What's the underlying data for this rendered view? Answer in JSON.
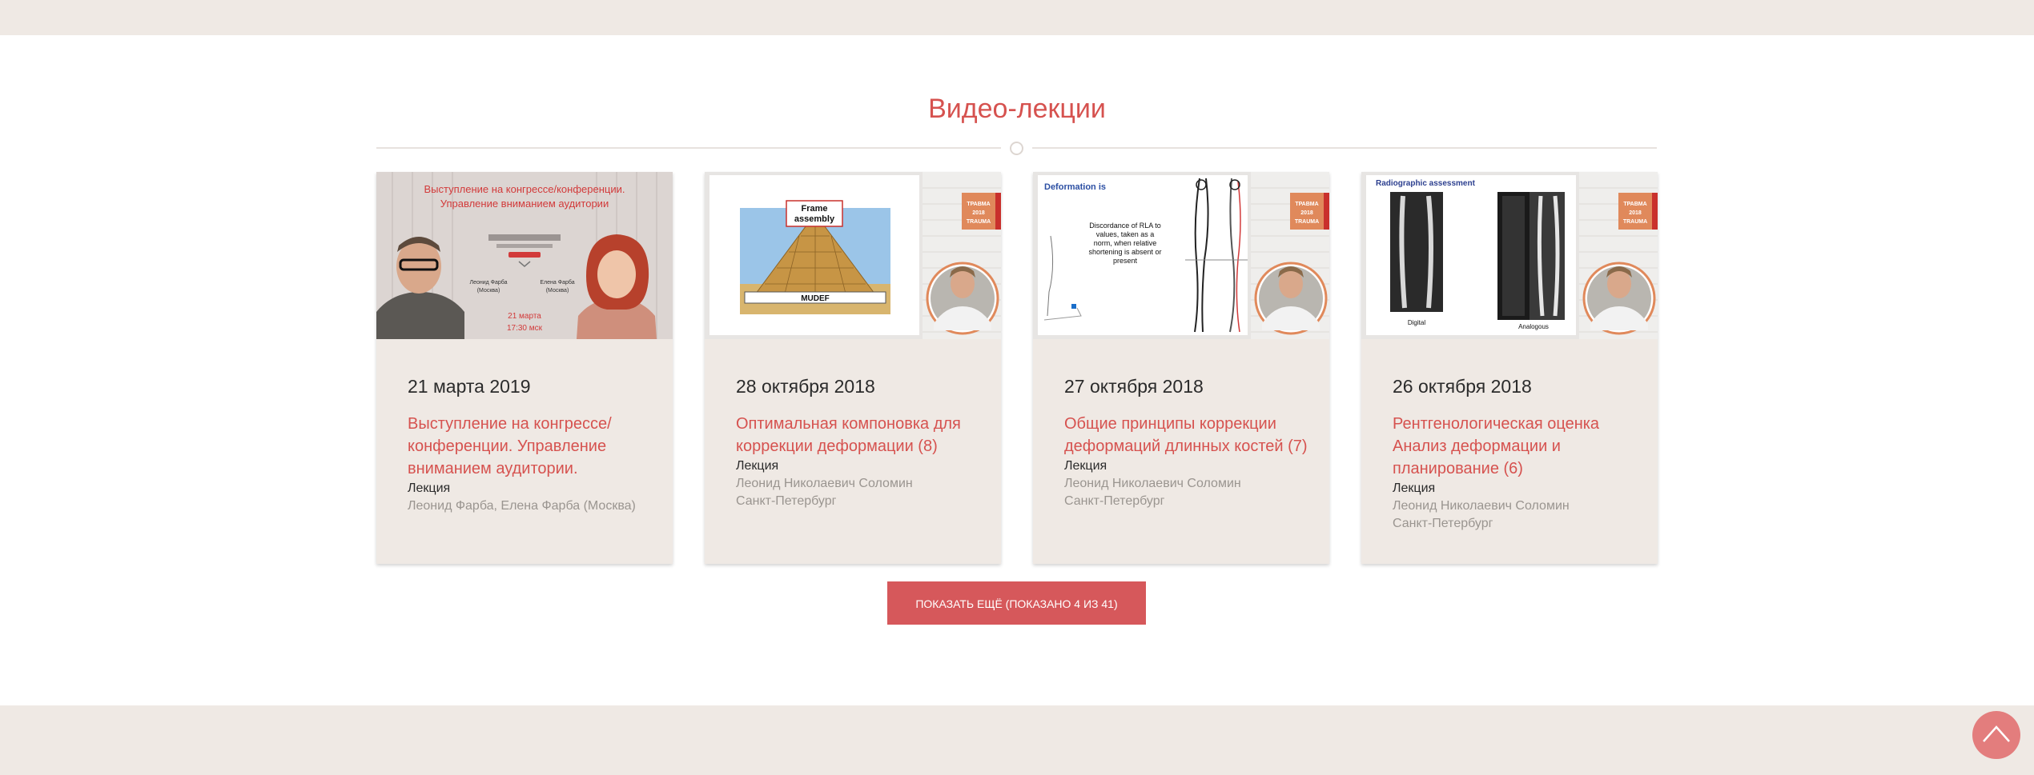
{
  "section": {
    "title": "Видео-лекции"
  },
  "cards": [
    {
      "date": "21 марта 2019",
      "title": "Выступление на конгрессе/ конференции. Управление вниманием аудитории.",
      "type": "Лекция",
      "author": "Леонид Фарба, Елена Фарба (Москва)",
      "city": "",
      "thumb": {
        "headline_1": "Выступление на конгрессе/конференции.",
        "headline_2": "Управление вниманием аудитории",
        "speaker_1": "Леонид Фарба",
        "speaker_1_city": "(Москва)",
        "speaker_2": "Елена Фарба",
        "speaker_2_city": "(Москва)",
        "event_date": "21 марта",
        "event_time": "17:30 мск"
      }
    },
    {
      "date": "28 октября 2018",
      "title": "Оптимальная компоновка для коррекции деформации (8)",
      "type": "Лекция",
      "author": "Леонид Николаевич Соломин",
      "city": "Санкт-Петербург",
      "thumb": {
        "slide_label_1": "Frame",
        "slide_label_2": "assembly",
        "slide_footer": "MUDEF",
        "badge": "ТРАВМА 2018 TRAUMA"
      }
    },
    {
      "date": "27 октября 2018",
      "title": "Общие принципы коррекции деформаций длинных костей (7)",
      "type": "Лекция",
      "author": "Леонид Николаевич Соломин",
      "city": "Санкт-Петербург",
      "thumb": {
        "slide_title": "Deformation is",
        "slide_text": [
          "Discordance of RLA to",
          "values, taken as a",
          "norm, when relative",
          "shortening is absent or",
          "present"
        ],
        "badge": "ТРАВМА 2018 TRAUMA"
      }
    },
    {
      "date": "26 октября 2018",
      "title": "Рентгенологическая оценка Анализ деформации и планирование (6)",
      "type": "Лекция",
      "author": "Леонид Николаевич Соломин",
      "city": "Санкт-Петербург",
      "thumb": {
        "slide_title": "Radiographic assessment",
        "label_left": "Digital",
        "label_right": "Analogous",
        "badge": "ТРАВМА 2018 TRAUMA"
      }
    }
  ],
  "show_more": {
    "label": "Показать ещё (показано 4 из 41)"
  },
  "next_section": {
    "title": ""
  },
  "icons": {
    "scroll_top": "chevron-up-icon"
  },
  "colors": {
    "accent": "#d6524f",
    "band": "#efe9e4",
    "card_bg": "#efe9e4",
    "button": "#d6585b"
  }
}
